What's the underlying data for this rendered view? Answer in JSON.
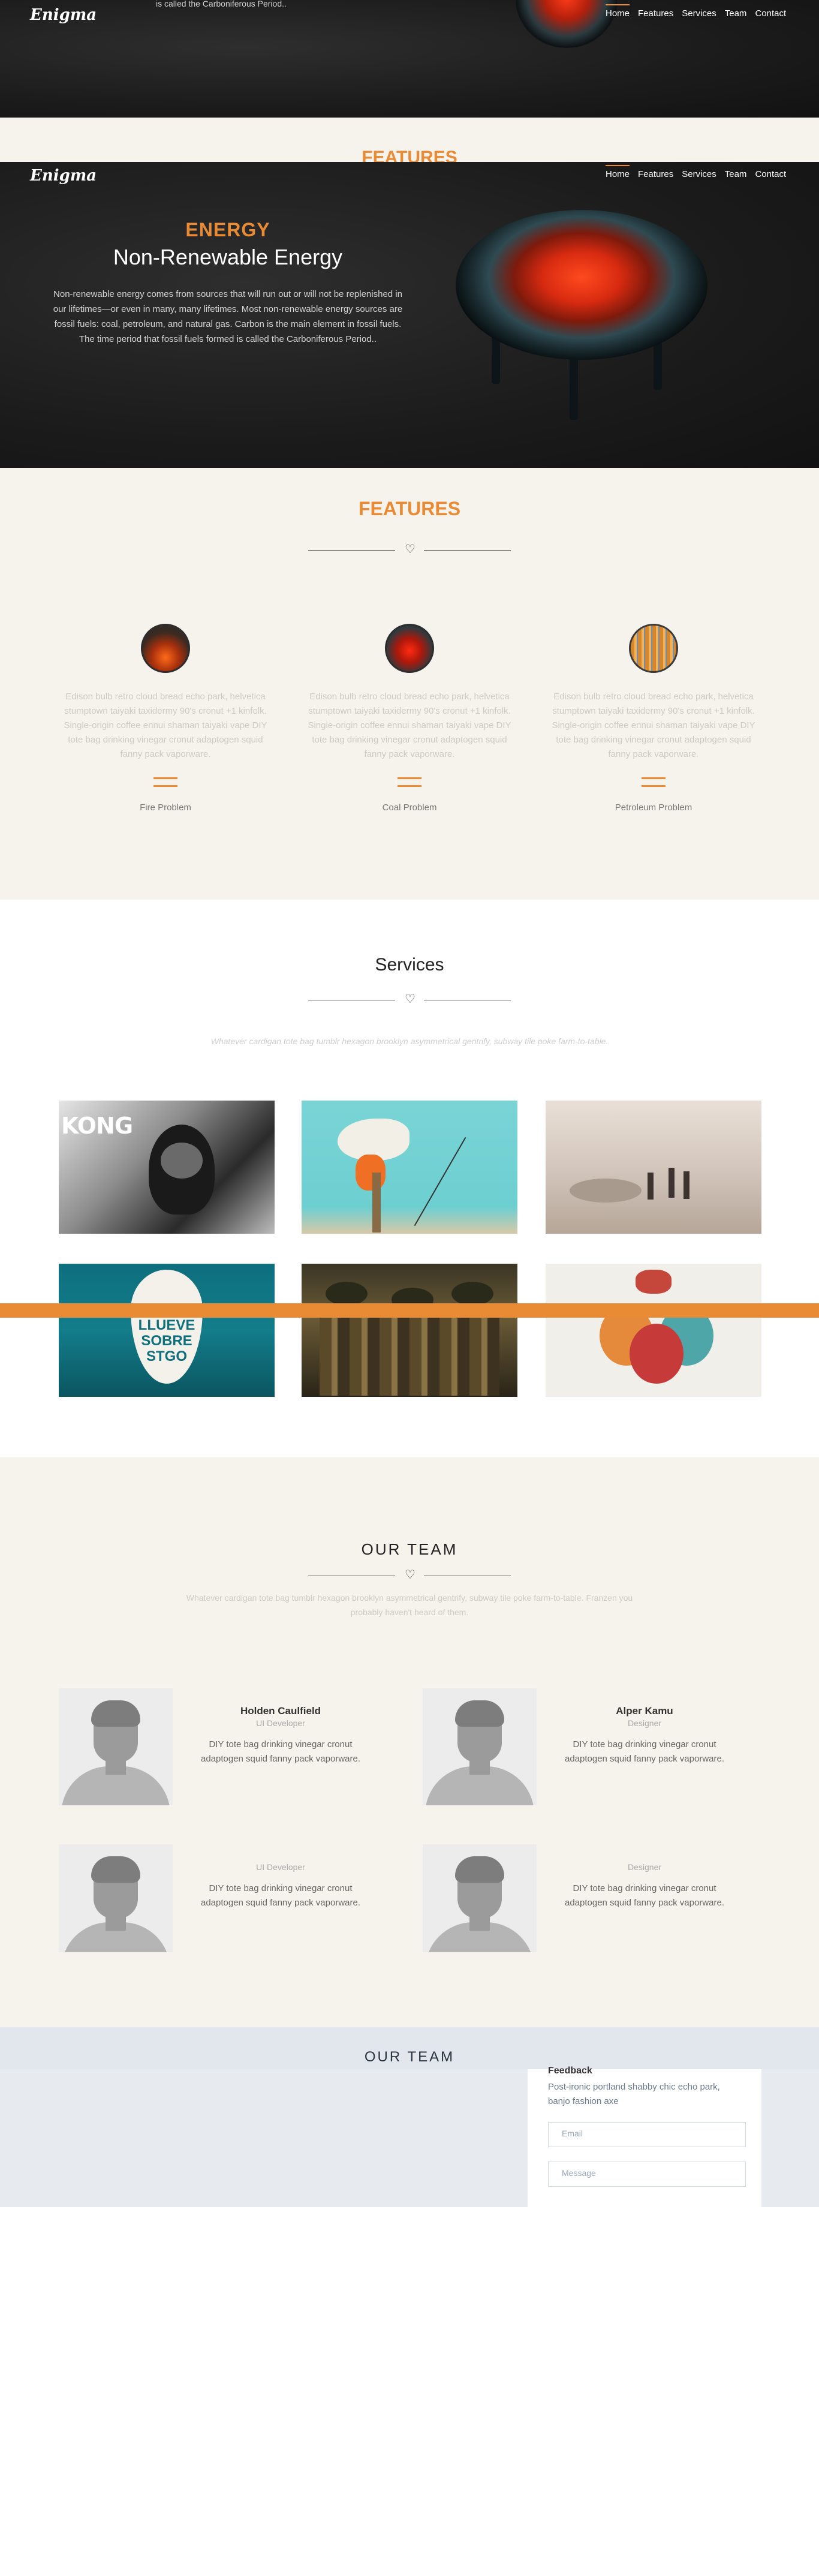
{
  "brand": {
    "logo": "Enigma"
  },
  "nav": [
    {
      "label": "Home",
      "active": true
    },
    {
      "label": "Features",
      "active": false
    },
    {
      "label": "Services",
      "active": false
    },
    {
      "label": "Team",
      "active": false
    },
    {
      "label": "Contact",
      "active": false
    }
  ],
  "top_strip": {
    "cut_text": "is called the Carboniferous Period.."
  },
  "ghost": {
    "features": "FEATURES"
  },
  "hero": {
    "kicker": "ENERGY",
    "headline": "Non-Renewable Energy",
    "body": "Non-renewable energy comes from sources that will run out or will not be replenished in our lifetimes—or even in many, many lifetimes.  Most non-renewable energy sources are fossil fuels: coal, petroleum, and natural gas. Carbon is the main element in fossil fuels. The time period that fossil fuels formed is called the Carboniferous Period.."
  },
  "features": {
    "title": "FEATURES",
    "items": [
      {
        "desc": "Edison bulb retro cloud bread echo park, helvetica stumptown taiyaki taxidermy 90's cronut +1 kinfolk. Single-origin coffee ennui shaman taiyaki vape DIY tote bag drinking vinegar cronut adaptogen squid fanny pack vaporware.",
        "label": "Fire Problem",
        "icon": "fire-icon"
      },
      {
        "desc": "Edison bulb retro cloud bread echo park, helvetica stumptown taiyaki taxidermy 90's cronut +1 kinfolk. Single-origin coffee ennui shaman taiyaki vape DIY tote bag drinking vinegar cronut adaptogen squid fanny pack vaporware.",
        "label": "Coal Problem",
        "icon": "coal-icon"
      },
      {
        "desc": "Edison bulb retro cloud bread echo park, helvetica stumptown taiyaki taxidermy 90's cronut +1 kinfolk. Single-origin coffee ennui shaman taiyaki vape DIY tote bag drinking vinegar cronut adaptogen squid fanny pack vaporware.",
        "label": "Petroleum Problem",
        "icon": "petroleum-icon"
      }
    ]
  },
  "services": {
    "title": "Services",
    "subtitle": "Whatever cardigan tote bag tumblr hexagon brooklyn asymmetrical gentrify, subway tile poke farm-to-table.",
    "tiles": [
      {
        "caption": "KONG"
      },
      {
        "caption": ""
      },
      {
        "caption": ""
      },
      {
        "caption": "LLUEVE SOBRE STGO"
      },
      {
        "caption": ""
      },
      {
        "caption": ""
      }
    ]
  },
  "team": {
    "title": "OUR TEAM",
    "subtitle": "Whatever cardigan tote bag tumblr hexagon brooklyn asymmetrical gentrify, subway tile poke farm-to-table. Franzen you probably haven't heard of them.",
    "members": [
      {
        "name": "Holden Caulfield",
        "role": "UI Developer",
        "bio": "DIY tote bag drinking vinegar cronut adaptogen squid fanny pack vaporware."
      },
      {
        "name": "Alper Kamu",
        "role": "Designer",
        "bio": "DIY tote bag drinking vinegar cronut adaptogen squid fanny pack vaporware."
      },
      {
        "name": "",
        "role": "UI Developer",
        "bio": "DIY tote bag drinking vinegar cronut adaptogen squid fanny pack vaporware."
      },
      {
        "name": "",
        "role": "Designer",
        "bio": "DIY tote bag drinking vinegar cronut adaptogen squid fanny pack vaporware."
      }
    ]
  },
  "contact": {
    "ghost_title": "OUR TEAM",
    "feedback_title": "Feedback",
    "feedback_text": "Post-ironic portland shabby chic echo park, banjo fashion axe",
    "email_placeholder": "Email",
    "message_placeholder": "Message"
  },
  "colors": {
    "accent": "#e98a35",
    "beige": "#f6f2ec",
    "dark": "#1b1b1b"
  }
}
